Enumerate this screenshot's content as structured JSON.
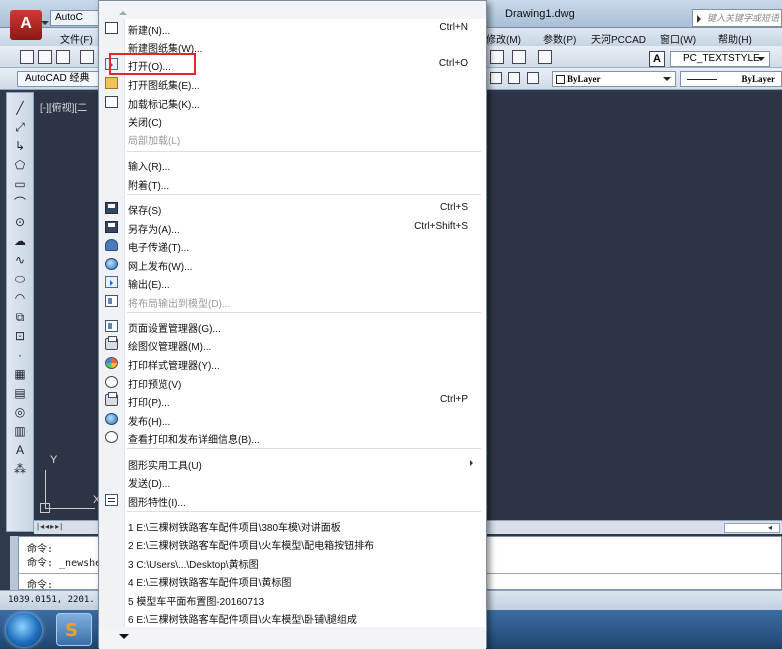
{
  "window": {
    "app_short_title": "AutoC",
    "document_title": "Drawing1.dwg",
    "search_placeholder": "键入关键字或短语"
  },
  "menubar": {
    "items": [
      {
        "label": "文件(F)"
      },
      {
        "label": "修改(M)"
      },
      {
        "label": "参数(P)"
      },
      {
        "label": "天河PCCAD"
      },
      {
        "label": "窗口(W)"
      },
      {
        "label": "帮助(H)"
      }
    ]
  },
  "toolbar": {
    "workspace": "AutoCAD 经典",
    "textstyle": "PC_TEXTSTYLE",
    "layer": "ByLayer",
    "linetype": "ByLayer"
  },
  "canvas": {
    "viewport_label": "[-][俯视][二",
    "ucs_y": "Y",
    "ucs_x": "X"
  },
  "command_line": {
    "line1": "命令:",
    "line2": "命令: _newshe",
    "prompt": "命令:"
  },
  "status_bar": {
    "coords": "1039.0151, 2201."
  },
  "app_menu": {
    "items": [
      {
        "label": "新建(N)...",
        "shortcut": "Ctrl+N",
        "icon": "new-doc-icon"
      },
      {
        "label": "新建图纸集(W)...",
        "shortcut": "",
        "icon": ""
      },
      {
        "label": "打开(O)...",
        "shortcut": "Ctrl+O",
        "icon": "open-folder-icon"
      },
      {
        "label": "打开图纸集(E)...",
        "shortcut": "",
        "icon": "open-sheetset-icon"
      },
      {
        "label": "加载标记集(K)...",
        "shortcut": "",
        "icon": "markup-icon"
      },
      {
        "label": "关闭(C)",
        "shortcut": "",
        "icon": ""
      },
      {
        "label": "局部加载(L)",
        "shortcut": "",
        "icon": "",
        "disabled": true
      },
      {
        "label": "输入(R)...",
        "shortcut": "",
        "icon": ""
      },
      {
        "label": "附着(T)...",
        "shortcut": "",
        "icon": ""
      },
      {
        "label": "保存(S)",
        "shortcut": "Ctrl+S",
        "icon": "save-icon"
      },
      {
        "label": "另存为(A)...",
        "shortcut": "Ctrl+Shift+S",
        "icon": "save-as-icon"
      },
      {
        "label": "电子传递(T)...",
        "shortcut": "",
        "icon": "etransmit-icon"
      },
      {
        "label": "网上发布(W)...",
        "shortcut": "",
        "icon": "publish-web-icon"
      },
      {
        "label": "输出(E)...",
        "shortcut": "",
        "icon": "export-icon"
      },
      {
        "label": "将布局输出到模型(D)...",
        "shortcut": "",
        "icon": "export-layout-icon",
        "disabled": true
      },
      {
        "label": "页面设置管理器(G)...",
        "shortcut": "",
        "icon": "page-setup-icon"
      },
      {
        "label": "绘图仪管理器(M)...",
        "shortcut": "",
        "icon": "plotter-icon"
      },
      {
        "label": "打印样式管理器(Y)...",
        "shortcut": "",
        "icon": "plot-style-icon"
      },
      {
        "label": "打印预览(V)",
        "shortcut": "",
        "icon": "print-preview-icon"
      },
      {
        "label": "打印(P)...",
        "shortcut": "Ctrl+P",
        "icon": "print-icon"
      },
      {
        "label": "发布(H)...",
        "shortcut": "",
        "icon": "publish-icon"
      },
      {
        "label": "查看打印和发布详细信息(B)...",
        "shortcut": "",
        "icon": "plot-details-icon"
      },
      {
        "label": "图形实用工具(U)",
        "shortcut": "",
        "icon": "",
        "submenu": true
      },
      {
        "label": "发送(D)...",
        "shortcut": "",
        "icon": ""
      },
      {
        "label": "图形特性(I)...",
        "shortcut": "",
        "icon": "drawing-props-icon"
      },
      {
        "label": "1 E:\\三棵树铁路客车配件项目\\380车模\\对讲面板",
        "shortcut": "",
        "icon": ""
      },
      {
        "label": "2 E:\\三棵树铁路客车配件项目\\火车模型\\配电箱按钮排布",
        "shortcut": "",
        "icon": ""
      },
      {
        "label": "3 C:\\Users\\...\\Desktop\\黄标图",
        "shortcut": "",
        "icon": ""
      },
      {
        "label": "4 E:\\三棵树铁路客车配件项目\\黄标图",
        "shortcut": "",
        "icon": ""
      },
      {
        "label": "5 模型车平面布置图-20160713",
        "shortcut": "",
        "icon": ""
      },
      {
        "label": "6 E:\\三棵树铁路客车配件项目\\火车模型\\卧铺\\腿组成",
        "shortcut": "",
        "icon": ""
      }
    ]
  },
  "colors": {
    "highlight_border": "#e2262a",
    "canvas_background": "#2c3545",
    "menu_background": "#ffffff"
  }
}
